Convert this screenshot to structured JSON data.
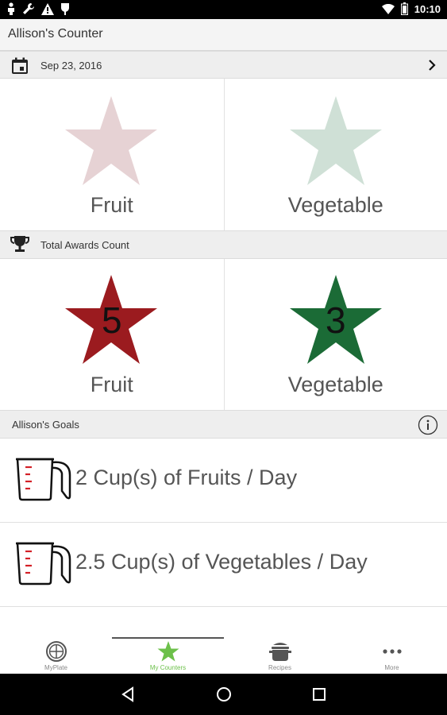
{
  "status_bar": {
    "time": "10:10",
    "left_icons": [
      "person-icon",
      "wrench-icon",
      "warning-icon",
      "android-icon"
    ],
    "right_icons": [
      "wifi-icon",
      "battery-icon"
    ]
  },
  "app_bar": {
    "title": "Allison's Counter"
  },
  "date_bar": {
    "date": "Sep 23, 2016",
    "icon": "calendar-icon",
    "next_icon": "chevron-right-icon"
  },
  "today": {
    "tiles": [
      {
        "label": "Fruit",
        "star_color": "#e6d2d4"
      },
      {
        "label": "Vegetable",
        "star_color": "#cfe0d6"
      }
    ]
  },
  "awards_bar": {
    "label": "Total Awards Count",
    "icon": "trophy-icon"
  },
  "awards": {
    "tiles": [
      {
        "label": "Fruit",
        "count": "5",
        "star_color": "#9b1b1f"
      },
      {
        "label": "Vegetable",
        "count": "3",
        "star_color": "#1b6b36"
      }
    ]
  },
  "goals_bar": {
    "label": "Allison's Goals",
    "icon": "info-icon"
  },
  "goals": [
    {
      "text": "2 Cup(s) of Fruits / Day",
      "icon": "measuring-cup-icon"
    },
    {
      "text": "2.5 Cup(s) of Vegetables / Day",
      "icon": "measuring-cup-icon"
    }
  ],
  "bottom_nav": {
    "items": [
      {
        "label": "MyPlate",
        "icon": "plate-icon",
        "active": false
      },
      {
        "label": "My Counters",
        "icon": "star-icon",
        "active": true
      },
      {
        "label": "Recipes",
        "icon": "pot-icon",
        "active": false
      },
      {
        "label": "More",
        "icon": "more-dots-icon",
        "active": false
      }
    ],
    "accent_color": "#6cc04a"
  },
  "android_nav": {
    "buttons": [
      "back-icon",
      "home-icon",
      "recents-icon"
    ]
  }
}
